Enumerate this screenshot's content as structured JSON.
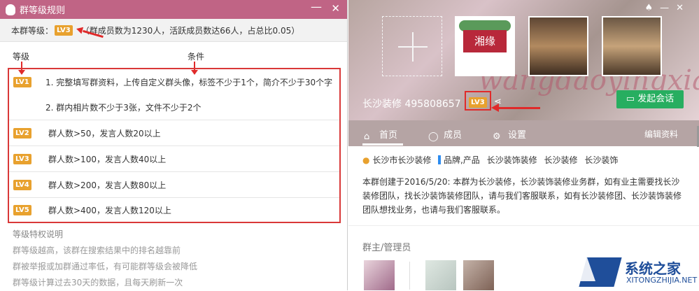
{
  "dialog": {
    "title": "群等级规则",
    "level_label": "本群等级：",
    "current_level": "LV3",
    "summary": "（群成员数为1230人，活跃成员数达66人，占总比0.05）",
    "col_level": "等级",
    "col_condition": "条件",
    "levels": [
      {
        "badge": "LV1",
        "text": "1. 完整填写群资料，上传自定义群头像，标签不少于1个，简介不少于30个字"
      },
      {
        "badge": "",
        "text": "2. 群内相片数不少于3张，文件不少于2个"
      },
      {
        "badge": "LV2",
        "text": "群人数>50，发言人数20以上"
      },
      {
        "badge": "LV3",
        "text": "群人数>100，发言人数40以上"
      },
      {
        "badge": "LV4",
        "text": "群人数>200，发言人数80以上"
      },
      {
        "badge": "LV5",
        "text": "群人数>400，发言人数120以上"
      }
    ],
    "notes_heading": "等级特权说明",
    "notes": [
      "群等级越高，该群在搜索结果中的排名越靠前",
      "群被举报或加群通过率低，有可能群等级会被降低",
      "群等级计算过去30天的数据，且每天刷新一次"
    ]
  },
  "group": {
    "name": "长沙装修 495808657",
    "badge": "LV3",
    "chat_button": "发起会话",
    "thumb_logo": "湘缘",
    "bg_text": "wangdaoyingxian",
    "tabs": [
      "首页",
      "成员",
      "设置"
    ],
    "edit_link": "编辑资料",
    "tags": [
      "长沙市长沙装修",
      "品牌,产品",
      "长沙装饰装修",
      "长沙装修",
      "长沙装饰"
    ],
    "description": "本群创建于2016/5/20: 本群为长沙装修，长沙装饰装修业务群，如有业主需要找长沙装修团队，找长沙装饰装修团队，请与我们客服联系，如有长沙装修团、长沙装饰装修团队想找业务，也请与我们客服联系。",
    "admins_label": "群主/管理员"
  },
  "watermark": {
    "name": "系统之家",
    "url": "XITONGZHIJIA.NET"
  },
  "colors": {
    "titlebar": "#c06485",
    "badge": "#e8a12e",
    "highlight": "#e02a2a",
    "chat_button": "#27ae60"
  }
}
